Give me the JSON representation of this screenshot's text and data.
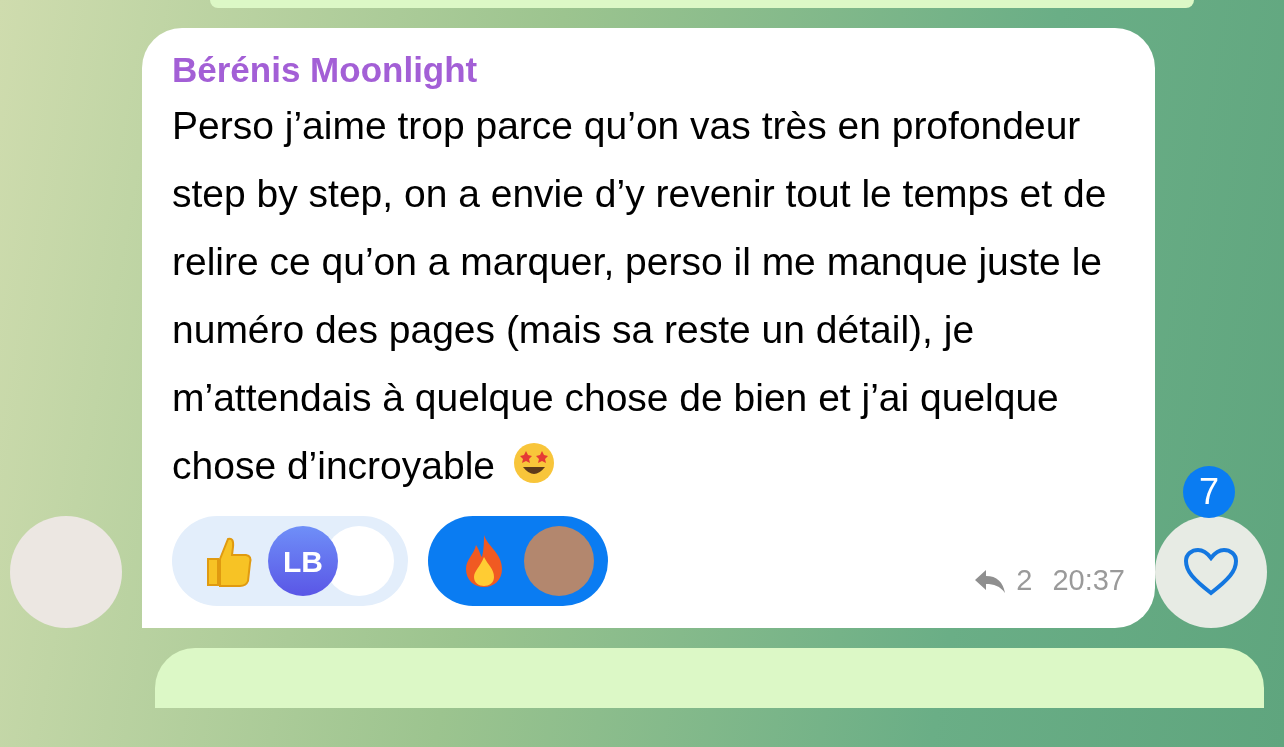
{
  "message": {
    "sender": "Bérénis Moonlight",
    "text": "Perso j’aime trop parce qu’on vas très en profondeur step by step, on a envie d’y revenir tout le temps et de relire ce qu’on a marquer, perso il me manque juste le numéro des pages (mais sa reste un détail), je m’attendais à quelque chose de bien et j’ai quelque chose d’incroyable",
    "reactions": [
      {
        "kind": "thumbs-up",
        "selected": false,
        "avatars": [
          {
            "kind": "initials",
            "initials": "LB"
          },
          {
            "kind": "logo"
          }
        ]
      },
      {
        "kind": "fire",
        "selected": true,
        "avatars": [
          {
            "kind": "photo"
          }
        ]
      }
    ],
    "replies": "2",
    "time": "20:37"
  },
  "comments": {
    "count": "7"
  }
}
